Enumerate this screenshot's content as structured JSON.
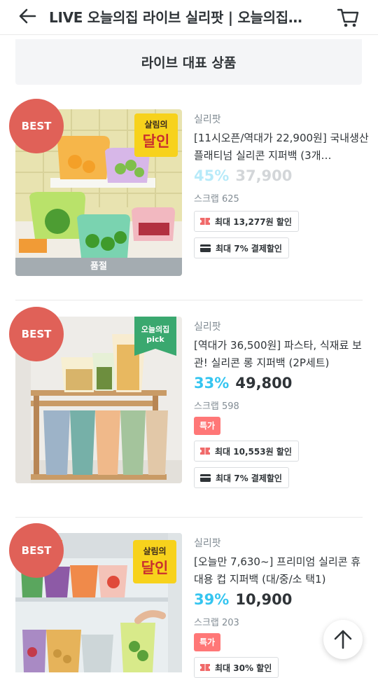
{
  "header": {
    "title": "LIVE 오늘의집 라이브 실리팟 | 오늘의집…",
    "back_icon": "arrow-left-icon",
    "cart_icon": "cart-icon"
  },
  "section": {
    "title": "라이브 대표 상품"
  },
  "products": [
    {
      "badge": "BEST",
      "sticker_line1": "살림의",
      "sticker_line2": "달인",
      "soldout_label": "품절",
      "seller": "실리팟",
      "name": "[11시오픈/역대가 22,900원] 국내생산 플래티넘 실리콘 지퍼백 (3개…",
      "discount": "45%",
      "price": "37,900",
      "scrap": "스크랩 625",
      "coupon": "최대 13,277원 할인",
      "payment": "최대 7% 결제할인"
    },
    {
      "badge": "BEST",
      "sticker_line1": "오늘의집",
      "sticker_line2": "pick",
      "seller": "실리팟",
      "name": "[역대가 36,500원] 파스타, 식재료 보관! 실리콘 롱 지퍼백 (2P세트)",
      "discount": "33%",
      "price": "49,800",
      "scrap": "스크랩 598",
      "special_tag": "특가",
      "coupon": "최대 10,553원 할인",
      "payment": "최대 7% 결제할인"
    },
    {
      "badge": "BEST",
      "sticker_line1": "살림의",
      "sticker_line2": "달인",
      "seller": "실리팟",
      "name": "[오늘만 7,630~] 프리미엄 실리콘 휴대용 컵 지퍼백 (대/중/소 택1)",
      "discount": "39%",
      "price": "10,900",
      "scrap": "스크랩 203",
      "special_tag": "특가",
      "coupon": "최대 30% 할인"
    }
  ],
  "colors": {
    "accent": "#35c5f0",
    "best": "#e06158",
    "special": "#ff7777",
    "pick": "#3aa86f"
  },
  "scroll_top_icon": "arrow-up-icon"
}
